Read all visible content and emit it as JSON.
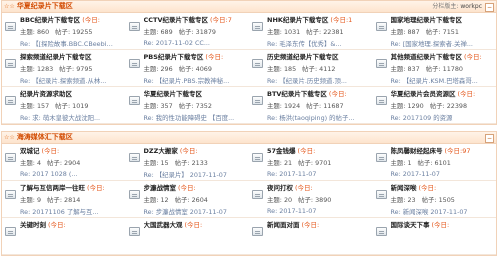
{
  "sections": [
    {
      "title": "华夏纪录片下载区",
      "stars": "☆☆",
      "moderators_label": "分栏版主:",
      "moderator": "workpc",
      "collapse": "−",
      "forums": [
        {
          "name": "BBC纪录片下载专区",
          "today": "(今日:",
          "topics": "主题: 860",
          "posts": "帖子: 19255",
          "last": "Re: 【[探险故事.BBC.CBeebies..."
        },
        {
          "name": "CCTV纪录片下载专区",
          "today": "(今日:7",
          "topics": "主题: 689",
          "posts": "帖子: 31879",
          "last": "Re: 2017-11-02  CC..."
        },
        {
          "name": "NHK纪录片下载专区",
          "today": "(今日:1",
          "topics": "主题: 1031",
          "posts": "帖子: 22381",
          "last": "Re: 毛泽东传【优秀】&..."
        },
        {
          "name": "国家地理纪录片下载专区",
          "today": "",
          "topics": "主题: 887",
          "posts": "帖子: 7151",
          "last": "Re: [国家地理.探索者.关禅..."
        },
        {
          "name": "探索频道纪录片下载专区",
          "today": "",
          "topics": "主题: 1283",
          "posts": "帖子: 9795",
          "last": "Re: 【纪录片.探索频道.从林..."
        },
        {
          "name": "PBS纪录片下载专区",
          "today": "(今日:",
          "topics": "主题: 296",
          "posts": "帖子: 4069",
          "last": "Re: 【纪录片.PBS.宗教神秘..."
        },
        {
          "name": "历史频道纪录片下载专区",
          "today": "",
          "topics": "主题: 185",
          "posts": "帖子: 4112",
          "last": "Re: 【纪录片.历史频道.顶..."
        },
        {
          "name": "其他频道纪录片下载专区",
          "today": "(今日:",
          "topics": "主题: 837",
          "posts": "帖子: 11780",
          "last": "Re: 【纪录片.KSM.巴塔森哥..."
        },
        {
          "name": "纪录片资源求助区",
          "today": "",
          "topics": "主题: 157",
          "posts": "帖子: 1019",
          "last": "Re: 求:  萌木皇彼大战沈阳..."
        },
        {
          "name": "华夏纪录片下载专区",
          "today": "",
          "topics": "主题: 357",
          "posts": "帖子: 7352",
          "last": "Re: 我的性功能障碍史  【百度..."
        },
        {
          "name": "BTV纪录片下载专区",
          "today": "(今日:",
          "topics": "主题: 1924",
          "posts": "帖子: 11687",
          "last": "Re: 杨洪(taoqiping) 的帖子..."
        },
        {
          "name": "华夏纪录片会员资源区",
          "today": "(今日:",
          "topics": "主题: 1290",
          "posts": "帖子: 22398",
          "last": "Re: 2017109 的资源"
        }
      ]
    },
    {
      "title": "海涛媒体汇下载区",
      "stars": "☆☆",
      "moderators_label": "",
      "moderator": "",
      "collapse": "−",
      "forums": [
        {
          "name": "双城记",
          "today": "(今日:",
          "topics": "主题: 4",
          "posts": "帖子: 2904",
          "last": "Re: 2017 1028 (..."
        },
        {
          "name": "DZZ大搬家",
          "today": "(今日:",
          "topics": "主题: 15",
          "posts": "帖子: 2133",
          "last": "Re: 【纪录片】 2017-11-07"
        },
        {
          "name": "57金钱爆",
          "today": "(今日:",
          "topics": "主题: 21",
          "posts": "帖子: 9701",
          "last": "Re: 2017-11-07"
        },
        {
          "name": "陈凤馨财经起床号",
          "today": "(今日:97",
          "topics": "主题: 1",
          "posts": "帖子: 6101",
          "last": "Re: 2017-11-07"
        },
        {
          "name": "了解与互信两岸一往旺",
          "today": "(今日:",
          "topics": "主题: 9",
          "posts": "帖子: 2814",
          "last": "Re: 20171106 了解与互..."
        },
        {
          "name": "步濂战情室",
          "today": "(今日:",
          "topics": "主题: 12",
          "posts": "帖子: 2604",
          "last": "Re: 步濂战情室 2017-11-07"
        },
        {
          "name": "夜问打权",
          "today": "(今日:",
          "topics": "主题: 20",
          "posts": "帖子: 3890",
          "last": "Re: 2017-11-07"
        },
        {
          "name": "新闻深喉",
          "today": "(今日:",
          "topics": "主题: 23",
          "posts": "帖子: 1505",
          "last": "Re: 新闻深喉 2017-11-07"
        },
        {
          "name": "关键时刻",
          "today": "(今日:",
          "topics": "",
          "posts": "",
          "last": ""
        },
        {
          "name": "大国武器大观",
          "today": "(今日:",
          "topics": "",
          "posts": "",
          "last": ""
        },
        {
          "name": "新闻面对面",
          "today": "(今日:",
          "topics": "",
          "posts": "",
          "last": ""
        },
        {
          "name": "国际谈天下事",
          "today": "(今日:",
          "topics": "",
          "posts": "",
          "last": ""
        }
      ]
    }
  ]
}
